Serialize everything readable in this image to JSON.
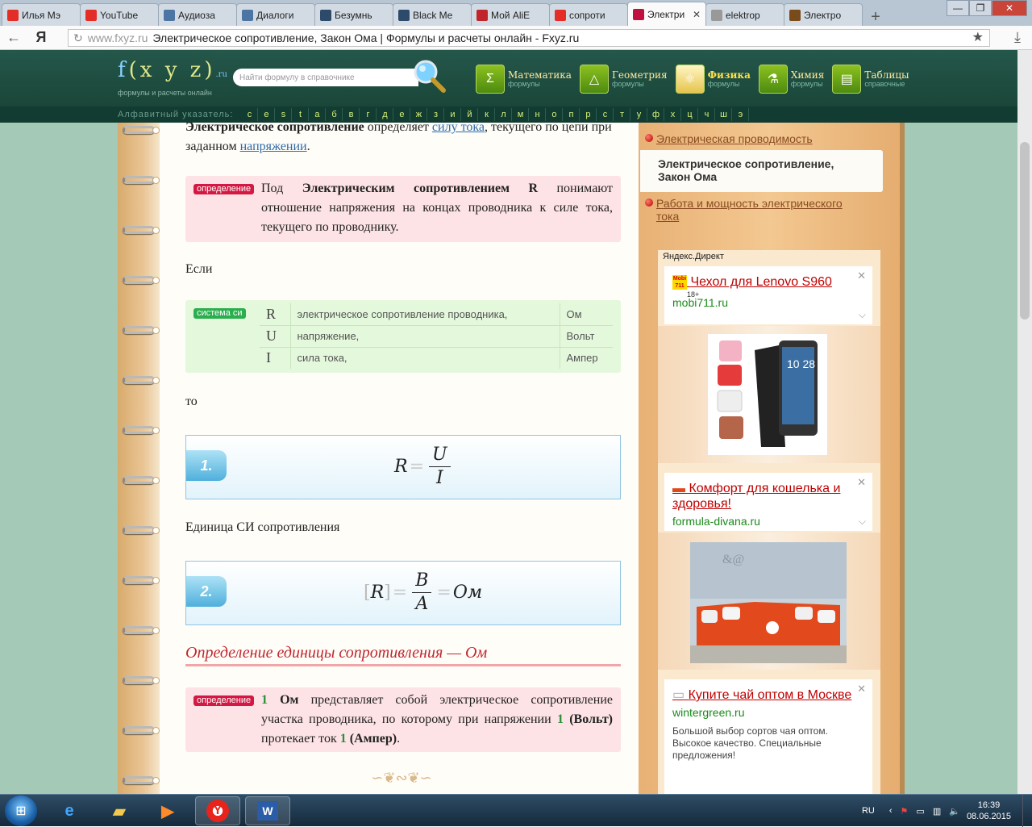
{
  "tabs": [
    {
      "label": "Илья Мэ",
      "icon": "youtube-icon",
      "color": "#e52d27"
    },
    {
      "label": "YouTube",
      "icon": "youtube-icon",
      "color": "#e52d27"
    },
    {
      "label": "Аудиоза",
      "icon": "vk-icon",
      "color": "#4c75a3"
    },
    {
      "label": "Диалоги",
      "icon": "vk-icon",
      "color": "#4c75a3"
    },
    {
      "label": "Безумнь",
      "icon": "page-icon",
      "color": "#2d4a6a"
    },
    {
      "label": "Black Me",
      "icon": "page-icon",
      "color": "#2d4a6a"
    },
    {
      "label": "Мой AliE",
      "icon": "cart-icon",
      "color": "#c0252b"
    },
    {
      "label": "сопроти",
      "icon": "yandex-icon",
      "color": "#e52d27"
    },
    {
      "label": "Электри",
      "icon": "fxyz-icon",
      "color": "#c01040",
      "active": true
    },
    {
      "label": "elektrop",
      "icon": "page-icon",
      "color": "#999999"
    },
    {
      "label": "Электро",
      "icon": "page-icon",
      "color": "#7a4b1a"
    }
  ],
  "address": {
    "domain": "www.fxyz.ru",
    "title": "Электрическое сопротивление, Закон Ома | Формулы и расчеты онлайн - Fxyz.ru",
    "yandex_glyph": "Я"
  },
  "header": {
    "logo_f": "f",
    "logo_main": "(x y z)",
    "logo_ru": ".ru",
    "logo_sub": "формулы и расчеты онлайн",
    "search_placeholder": "Найти формулу в справочнике",
    "categories": [
      {
        "name": "Математика",
        "sub": "формулы",
        "glyph": "Σ"
      },
      {
        "name": "Геометрия",
        "sub": "формулы",
        "glyph": "△"
      },
      {
        "name": "Физика",
        "sub": "формулы",
        "glyph": "⚛",
        "selected": true
      },
      {
        "name": "Химия",
        "sub": "формулы",
        "glyph": "⚗"
      },
      {
        "name": "Таблицы",
        "sub": "справочные",
        "glyph": "▤"
      }
    ]
  },
  "alphabet": {
    "label": "Алфавитный указатель:",
    "letters": [
      "c",
      "e",
      "s",
      "t",
      "а",
      "б",
      "в",
      "г",
      "д",
      "е",
      "ж",
      "з",
      "и",
      "й",
      "к",
      "л",
      "м",
      "н",
      "о",
      "п",
      "р",
      "с",
      "т",
      "у",
      "ф",
      "х",
      "ц",
      "ч",
      "ш",
      "э"
    ]
  },
  "article": {
    "intro_bold": "Электрическое сопротивление",
    "intro_1": "определяет",
    "intro_link1": "силу тока",
    "intro_2": ", текущего по цепи при заданном",
    "intro_link2": "напряжении",
    "intro_3": ".",
    "def_tag": "определение",
    "def1_a": "Под",
    "def1_b": "Электрическим сопротивлением R",
    "def1_c": "понимают отношение напряжения на концах проводника к силе тока, текущего по проводнику.",
    "if_text": "Если",
    "si_tag": "система си",
    "si_rows": [
      {
        "sym": "R",
        "desc": "электрическое сопротивление проводника,",
        "unit": "Ом"
      },
      {
        "sym": "U",
        "desc": "напряжение,",
        "unit": "Вольт"
      },
      {
        "sym": "I",
        "desc": "сила тока,",
        "unit": "Ампер"
      }
    ],
    "then_text": "то",
    "f1_num": "1.",
    "f1_lhs": "R",
    "f1_eq": "=",
    "f1_num_t": "U",
    "f1_den": "I",
    "unit_text": "Единица СИ сопротивления",
    "f2_num": "2.",
    "f2_lb": "[",
    "f2_sym": "R",
    "f2_rb": "]",
    "f2_eq1": "=",
    "f2_numr": "В",
    "f2_den": "А",
    "f2_eq2": "=",
    "f2_res": "Ом",
    "section_title": "Определение единицы сопротивления — Ом",
    "def2_n1": "1",
    "def2_a": "Ом",
    "def2_b": "представляет собой электрическое сопротивление участка проводника, по которому при напряжении",
    "def2_n2": "1",
    "def2_c": "(Вольт)",
    "def2_d": "протекает ток",
    "def2_n3": "1",
    "def2_e": "(Ампер)",
    "def2_f": "."
  },
  "sidebar": {
    "link1": "Электрическая проводимость",
    "current": "Электрическое сопротивление, Закон Ома",
    "link2": "Работа и мощность электрического тока",
    "direct_title": "Яндекс.Директ",
    "ads": [
      {
        "title": "Чехол для Lenovo S960",
        "domain": "mobi711.ru",
        "badge": "18+"
      },
      {
        "title": "Комфорт для кошелька и здоровья!",
        "domain": "formula-divana.ru"
      },
      {
        "title": "Купите чай оптом в Москве",
        "domain": "wintergreen.ru",
        "text": "Большой выбор сортов чая оптом. Высокое качество. Специальные предложения!"
      }
    ]
  },
  "taskbar": {
    "lang": "RU",
    "time": "16:39",
    "date": "08.06.2015"
  }
}
